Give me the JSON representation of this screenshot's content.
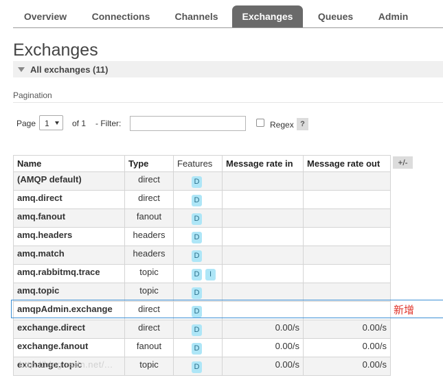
{
  "tabs": [
    {
      "label": "Overview",
      "active": false
    },
    {
      "label": "Connections",
      "active": false
    },
    {
      "label": "Channels",
      "active": false
    },
    {
      "label": "Exchanges",
      "active": true
    },
    {
      "label": "Queues",
      "active": false
    },
    {
      "label": "Admin",
      "active": false
    }
  ],
  "page_title": "Exchanges",
  "section": {
    "label": "All exchanges (11)",
    "icon": "triangle-down-icon"
  },
  "pagination": {
    "label": "Pagination",
    "page_label": "Page",
    "page_value": "1",
    "of_label": "of 1",
    "filter_label": "- Filter:",
    "filter_value": "",
    "regex_label": "Regex",
    "regex_checked": false,
    "help_label": "?"
  },
  "table": {
    "columns": [
      "Name",
      "Type",
      "Features",
      "Message rate in",
      "Message rate out"
    ],
    "plusminus": "+/-",
    "rows": [
      {
        "name": "(AMQP default)",
        "type": "direct",
        "features": [
          "D"
        ],
        "rate_in": "",
        "rate_out": ""
      },
      {
        "name": "amq.direct",
        "type": "direct",
        "features": [
          "D"
        ],
        "rate_in": "",
        "rate_out": ""
      },
      {
        "name": "amq.fanout",
        "type": "fanout",
        "features": [
          "D"
        ],
        "rate_in": "",
        "rate_out": ""
      },
      {
        "name": "amq.headers",
        "type": "headers",
        "features": [
          "D"
        ],
        "rate_in": "",
        "rate_out": ""
      },
      {
        "name": "amq.match",
        "type": "headers",
        "features": [
          "D"
        ],
        "rate_in": "",
        "rate_out": ""
      },
      {
        "name": "amq.rabbitmq.trace",
        "type": "topic",
        "features": [
          "D",
          "I"
        ],
        "rate_in": "",
        "rate_out": ""
      },
      {
        "name": "amq.topic",
        "type": "topic",
        "features": [
          "D"
        ],
        "rate_in": "",
        "rate_out": ""
      },
      {
        "name": "amqpAdmin.exchange",
        "type": "direct",
        "features": [
          "D"
        ],
        "rate_in": "",
        "rate_out": ""
      },
      {
        "name": "exchange.direct",
        "type": "direct",
        "features": [
          "D"
        ],
        "rate_in": "0.00/s",
        "rate_out": "0.00/s"
      },
      {
        "name": "exchange.fanout",
        "type": "fanout",
        "features": [
          "D"
        ],
        "rate_in": "0.00/s",
        "rate_out": "0.00/s"
      },
      {
        "name": "exchange.topic",
        "type": "topic",
        "features": [
          "D"
        ],
        "rate_in": "0.00/s",
        "rate_out": "0.00/s"
      }
    ]
  },
  "annotation": {
    "label": "新增",
    "color": "#e0342a"
  },
  "watermark": "http://blog.csdn.net/...",
  "colors": {
    "active_tab": "#6a6a6a",
    "badge_bg": "#aee6f7",
    "highlight_border": "#3b8fd5"
  }
}
